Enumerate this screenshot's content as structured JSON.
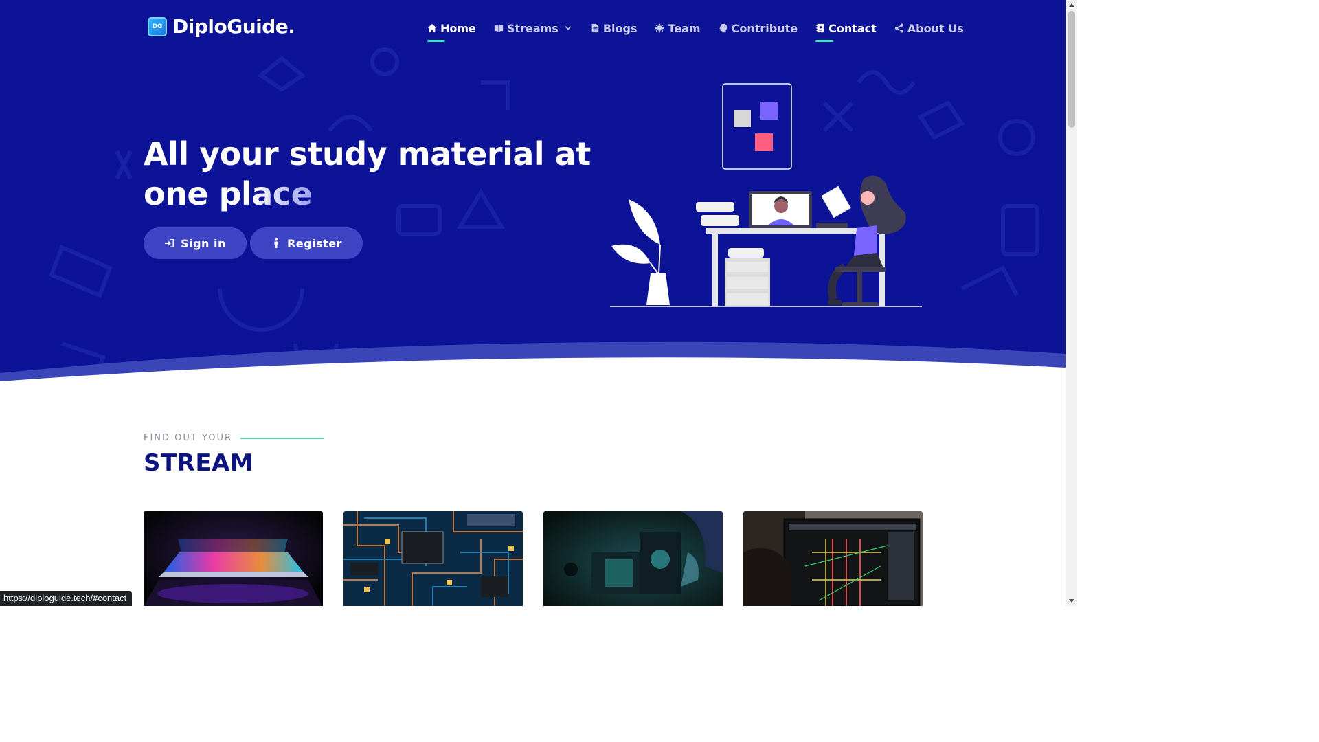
{
  "brand": {
    "name": "DiploGuide.",
    "badge": "DG"
  },
  "nav": {
    "items": [
      {
        "label": "Home",
        "icon": "home-icon",
        "active": true
      },
      {
        "label": "Streams",
        "icon": "book-icon",
        "active": false
      },
      {
        "label": "Blogs",
        "icon": "blog-icon",
        "active": false
      },
      {
        "label": "Team",
        "icon": "team-icon",
        "active": false
      },
      {
        "label": "Contribute",
        "icon": "contribute-icon",
        "active": false
      },
      {
        "label": "Contact",
        "icon": "contact-icon",
        "active": true
      },
      {
        "label": "About Us",
        "icon": "share-icon",
        "active": false
      }
    ]
  },
  "hero": {
    "headline_line1": "All your study material at",
    "headline_line2_plain": "one pl",
    "headline_line2_fade": "ace",
    "signin_label": "Sign in",
    "register_label": "Register"
  },
  "stream_section": {
    "kicker": "FIND OUT YOUR",
    "title": "STREAM"
  },
  "status_bar": {
    "url": "https://diploguide.tech/#contact"
  },
  "colors": {
    "hero_bg": "#0c1396",
    "button_bg": "#3d45c4",
    "accent": "#2ee6b8",
    "title_dark": "#0d1480"
  }
}
